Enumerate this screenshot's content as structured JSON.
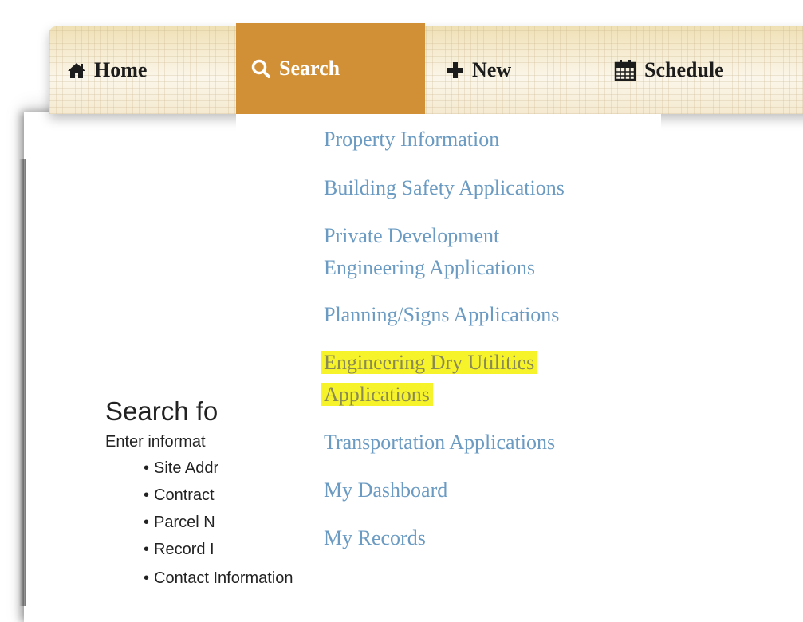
{
  "nav": {
    "home": {
      "label": "Home",
      "icon": "home-icon"
    },
    "search": {
      "label": "Search",
      "icon": "search-icon"
    },
    "new": {
      "label": "New",
      "icon": "plus-icon"
    },
    "schedule": {
      "label": "Schedule",
      "icon": "calendar-icon"
    }
  },
  "menu": {
    "items": [
      {
        "label": "Property Information"
      },
      {
        "label": "Building Safety Applications"
      },
      {
        "line1": "Private Development",
        "line2": "Engineering Applications"
      },
      {
        "label": "Planning/Signs Applications"
      },
      {
        "line1": "Engineering Dry Utilities",
        "line2": "Applications",
        "highlighted": true
      },
      {
        "label": "Transportation Applications"
      },
      {
        "label": "My Dashboard"
      },
      {
        "label": "My Records"
      }
    ]
  },
  "search_section": {
    "heading": "Search fo",
    "intro": "Enter informat",
    "criteria": [
      "Site Addr",
      "Contract",
      "Parcel N",
      "Record I"
    ],
    "last_criterion": "Contact Information"
  },
  "colors": {
    "nav_active": "#d29036",
    "menu_link": "#6b9bc2",
    "highlight": "#f7f32a"
  }
}
